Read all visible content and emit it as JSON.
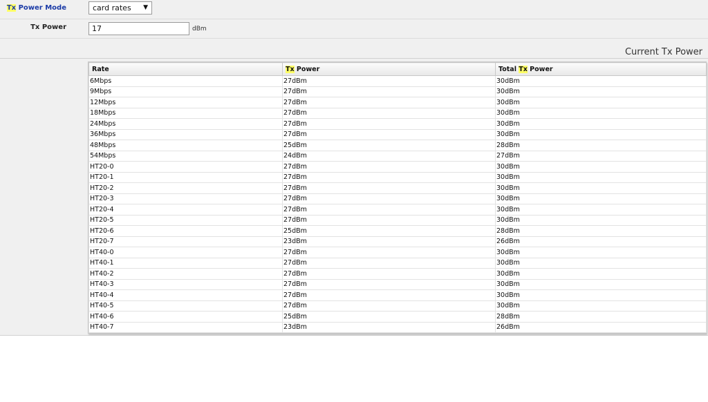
{
  "form": {
    "tx_power_mode": {
      "label_prefix": "Tx",
      "label_suffix": " Power Mode",
      "value": "card rates"
    },
    "tx_power": {
      "label": "Tx Power",
      "value": "17",
      "unit": "dBm"
    }
  },
  "section": {
    "title": "Current Tx Power"
  },
  "table": {
    "headers": {
      "rate": "Rate",
      "tx_power_prefix": "Tx",
      "tx_power_suffix": " Power",
      "total_prefix": "Total ",
      "total_hl": "Tx",
      "total_suffix": " Power"
    },
    "rows": [
      [
        "6Mbps",
        "27dBm",
        "30dBm"
      ],
      [
        "9Mbps",
        "27dBm",
        "30dBm"
      ],
      [
        "12Mbps",
        "27dBm",
        "30dBm"
      ],
      [
        "18Mbps",
        "27dBm",
        "30dBm"
      ],
      [
        "24Mbps",
        "27dBm",
        "30dBm"
      ],
      [
        "36Mbps",
        "27dBm",
        "30dBm"
      ],
      [
        "48Mbps",
        "25dBm",
        "28dBm"
      ],
      [
        "54Mbps",
        "24dBm",
        "27dBm"
      ],
      [
        "HT20-0",
        "27dBm",
        "30dBm"
      ],
      [
        "HT20-1",
        "27dBm",
        "30dBm"
      ],
      [
        "HT20-2",
        "27dBm",
        "30dBm"
      ],
      [
        "HT20-3",
        "27dBm",
        "30dBm"
      ],
      [
        "HT20-4",
        "27dBm",
        "30dBm"
      ],
      [
        "HT20-5",
        "27dBm",
        "30dBm"
      ],
      [
        "HT20-6",
        "25dBm",
        "28dBm"
      ],
      [
        "HT20-7",
        "23dBm",
        "26dBm"
      ],
      [
        "HT40-0",
        "27dBm",
        "30dBm"
      ],
      [
        "HT40-1",
        "27dBm",
        "30dBm"
      ],
      [
        "HT40-2",
        "27dBm",
        "30dBm"
      ],
      [
        "HT40-3",
        "27dBm",
        "30dBm"
      ],
      [
        "HT40-4",
        "27dBm",
        "30dBm"
      ],
      [
        "HT40-5",
        "27dBm",
        "30dBm"
      ],
      [
        "HT40-6",
        "25dBm",
        "28dBm"
      ],
      [
        "HT40-7",
        "23dBm",
        "26dBm"
      ]
    ]
  },
  "colors": {
    "highlight": "#ffff66",
    "link": "#1a3aa6"
  }
}
